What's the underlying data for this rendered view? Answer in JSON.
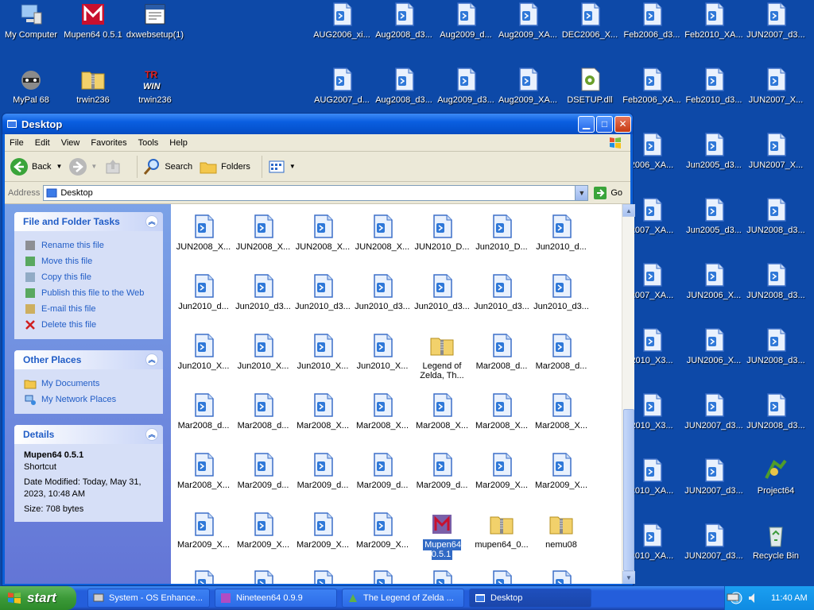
{
  "desktop": {
    "icons": [
      {
        "label": "My Computer",
        "icon": "computer-icon"
      },
      {
        "label": "Mupen64 0.5.1",
        "icon": "mupen-icon"
      },
      {
        "label": "dxwebsetup(1)",
        "icon": "installer-icon"
      },
      {
        "label": "MyPal 68",
        "icon": "raccoon-icon"
      },
      {
        "label": "trwin236",
        "icon": "zip-folder-icon"
      },
      {
        "label": "trwin236",
        "icon": "trwin-icon"
      },
      {
        "label": "AUG2006_xi...",
        "icon": "file-icon"
      },
      {
        "label": "Aug2008_d3...",
        "icon": "file-icon"
      },
      {
        "label": "Aug2009_d...",
        "icon": "file-icon"
      },
      {
        "label": "Aug2009_XA...",
        "icon": "file-icon"
      },
      {
        "label": "DEC2006_X...",
        "icon": "file-icon"
      },
      {
        "label": "Feb2006_d3...",
        "icon": "file-icon"
      },
      {
        "label": "Feb2010_XA...",
        "icon": "file-icon"
      },
      {
        "label": "JUN2007_d3...",
        "icon": "file-icon"
      },
      {
        "label": "AUG2007_d...",
        "icon": "file-icon"
      },
      {
        "label": "Aug2008_d3...",
        "icon": "file-icon"
      },
      {
        "label": "Aug2009_d3...",
        "icon": "file-icon"
      },
      {
        "label": "Aug2009_XA...",
        "icon": "file-icon"
      },
      {
        "label": "DSETUP.dll",
        "icon": "dll-icon"
      },
      {
        "label": "Feb2006_XA...",
        "icon": "file-icon"
      },
      {
        "label": "Feb2010_d3...",
        "icon": "file-icon"
      },
      {
        "label": "JUN2007_X...",
        "icon": "file-icon"
      },
      {
        "label": "2006_XA...",
        "icon": "file-icon"
      },
      {
        "label": "Jun2005_d3...",
        "icon": "file-icon"
      },
      {
        "label": "JUN2007_X...",
        "icon": "file-icon"
      },
      {
        "label": "2007_XA...",
        "icon": "file-icon"
      },
      {
        "label": "Jun2005_d3...",
        "icon": "file-icon"
      },
      {
        "label": "JUN2008_d3...",
        "icon": "file-icon"
      },
      {
        "label": "2007_XA...",
        "icon": "file-icon"
      },
      {
        "label": "JUN2006_X...",
        "icon": "file-icon"
      },
      {
        "label": "JUN2008_d3...",
        "icon": "file-icon"
      },
      {
        "label": "2010_X3...",
        "icon": "file-icon"
      },
      {
        "label": "JUN2006_X...",
        "icon": "file-icon"
      },
      {
        "label": "JUN2008_d3...",
        "icon": "file-icon"
      },
      {
        "label": "2010_X3...",
        "icon": "file-icon"
      },
      {
        "label": "JUN2007_d3...",
        "icon": "file-icon"
      },
      {
        "label": "JUN2008_d3...",
        "icon": "file-icon"
      },
      {
        "label": "2010_XA...",
        "icon": "file-icon"
      },
      {
        "label": "JUN2007_d3...",
        "icon": "file-icon"
      },
      {
        "label": "Project64",
        "icon": "project64-icon"
      },
      {
        "label": "2010_XA...",
        "icon": "file-icon"
      },
      {
        "label": "JUN2007_d3...",
        "icon": "file-icon"
      },
      {
        "label": "Recycle Bin",
        "icon": "recycle-bin-icon"
      }
    ]
  },
  "window": {
    "title": "Desktop",
    "menu": [
      "File",
      "Edit",
      "View",
      "Favorites",
      "Tools",
      "Help"
    ],
    "toolbar": {
      "back": "Back",
      "search": "Search",
      "folders": "Folders"
    },
    "address": {
      "label": "Address",
      "value": "Desktop",
      "go": "Go"
    }
  },
  "taskpane": {
    "file_tasks": {
      "title": "File and Folder Tasks",
      "items": [
        "Rename this file",
        "Move this file",
        "Copy this file",
        "Publish this file to the Web",
        "E-mail this file",
        "Delete this file"
      ]
    },
    "other_places": {
      "title": "Other Places",
      "items": [
        "My Documents",
        "My Network Places"
      ]
    },
    "details": {
      "title": "Details",
      "name": "Mupen64 0.5.1",
      "type": "Shortcut",
      "modified": "Date Modified: Today, May 31, 2023, 10:48 AM",
      "size": "Size: 708 bytes"
    }
  },
  "files": [
    "JUN2008_X...",
    "JUN2008_X...",
    "JUN2008_X...",
    "JUN2008_X...",
    "JUN2010_D...",
    "Jun2010_D...",
    "Jun2010_d...",
    "Jun2010_d...",
    "Jun2010_d3...",
    "Jun2010_d3...",
    "Jun2010_d3...",
    "Jun2010_d3...",
    "Jun2010_d3...",
    "Jun2010_d3...",
    "Jun2010_X...",
    "Jun2010_X...",
    "Jun2010_X...",
    "Jun2010_X...",
    "Legend of Zelda, Th...",
    "Mar2008_d...",
    "Mar2008_d...",
    "Mar2008_d...",
    "Mar2008_d...",
    "Mar2008_X...",
    "Mar2008_X...",
    "Mar2008_X...",
    "Mar2008_X...",
    "Mar2008_X...",
    "Mar2008_X...",
    "Mar2009_d...",
    "Mar2009_d...",
    "Mar2009_d...",
    "Mar2009_d...",
    "Mar2009_X...",
    "Mar2009_X...",
    "Mar2009_X...",
    "Mar2009_X...",
    "Mar2009_X...",
    "Mar2009_X...",
    "Mupen64 0.5.1",
    "mupen64_0...",
    "nemu08"
  ],
  "taskbar": {
    "start": "start",
    "tasks": [
      "System - OS Enhance...",
      "Nineteen64 0.9.9",
      "The Legend of Zelda ...",
      "Desktop"
    ],
    "clock": "11:40 AM"
  }
}
